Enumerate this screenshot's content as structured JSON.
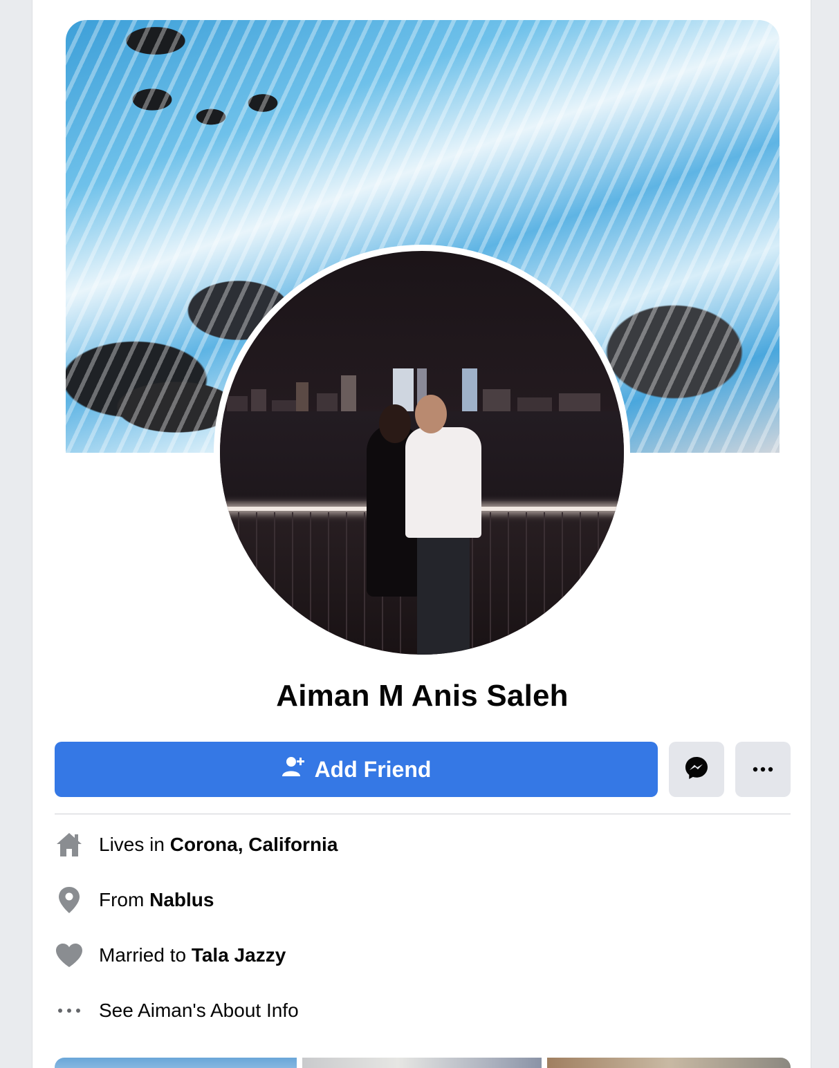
{
  "profile": {
    "name": "Aiman M Anis Saleh",
    "cover_photo_icon": "ocean-rocks-cover-photo",
    "profile_photo_icon": "couple-city-skyline-photo"
  },
  "actions": {
    "add_friend_label": "Add Friend",
    "add_friend_icon": "add-person-icon",
    "messenger_icon": "messenger-icon",
    "more_icon": "more-dots-icon",
    "accent_color": "#3578e5"
  },
  "intro": {
    "lives_in": {
      "prefix": "Lives in ",
      "value": "Corona, California",
      "icon": "home-icon"
    },
    "from": {
      "prefix": "From ",
      "value": "Nablus",
      "icon": "location-pin-icon"
    },
    "relationship": {
      "prefix": "Married to ",
      "value": "Tala Jazzy",
      "icon": "heart-icon"
    },
    "about": {
      "label": "See Aiman's About Info",
      "icon": "more-dots-icon"
    }
  }
}
